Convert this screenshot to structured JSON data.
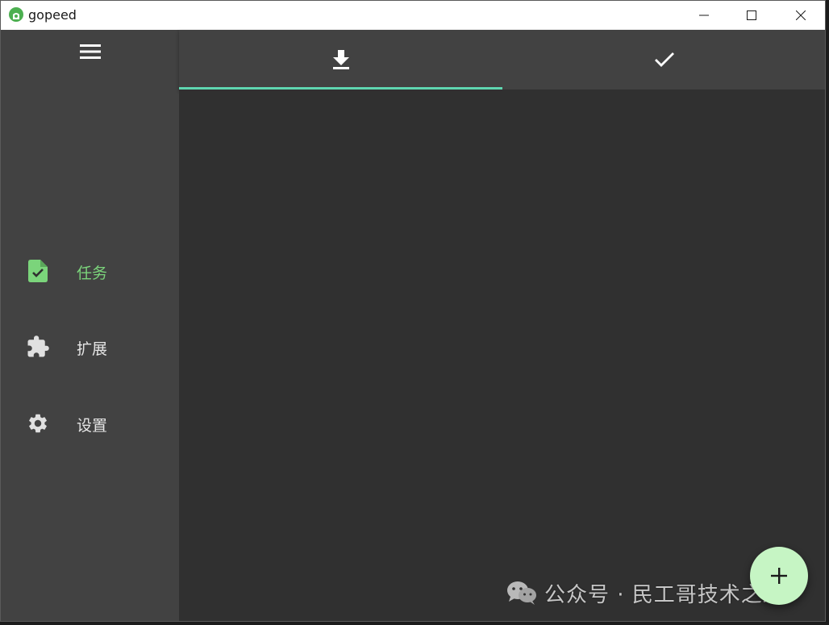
{
  "window": {
    "title": "gopeed",
    "controls": [
      "minimize-icon",
      "maximize-icon",
      "close-icon"
    ]
  },
  "sidebar": {
    "menu_icon": "menu-icon",
    "items": [
      {
        "label": "任务",
        "icon": "task-file-check-icon",
        "active": true
      },
      {
        "label": "扩展",
        "icon": "puzzle-extension-icon",
        "active": false
      },
      {
        "label": "设置",
        "icon": "gear-icon",
        "active": false
      }
    ]
  },
  "tabs": [
    {
      "icon": "download-icon",
      "active": true
    },
    {
      "icon": "check-icon",
      "active": false
    }
  ],
  "fab": {
    "icon": "plus-icon"
  },
  "watermark": {
    "icon": "wechat-icon",
    "text": "公众号 · 民工哥技术之路"
  },
  "colors": {
    "accent_green": "#7bd47b",
    "tab_indicator": "#5fd6b0",
    "fab_bg": "#c6f5c4",
    "sidebar_bg": "#424242",
    "content_bg": "#303030"
  }
}
